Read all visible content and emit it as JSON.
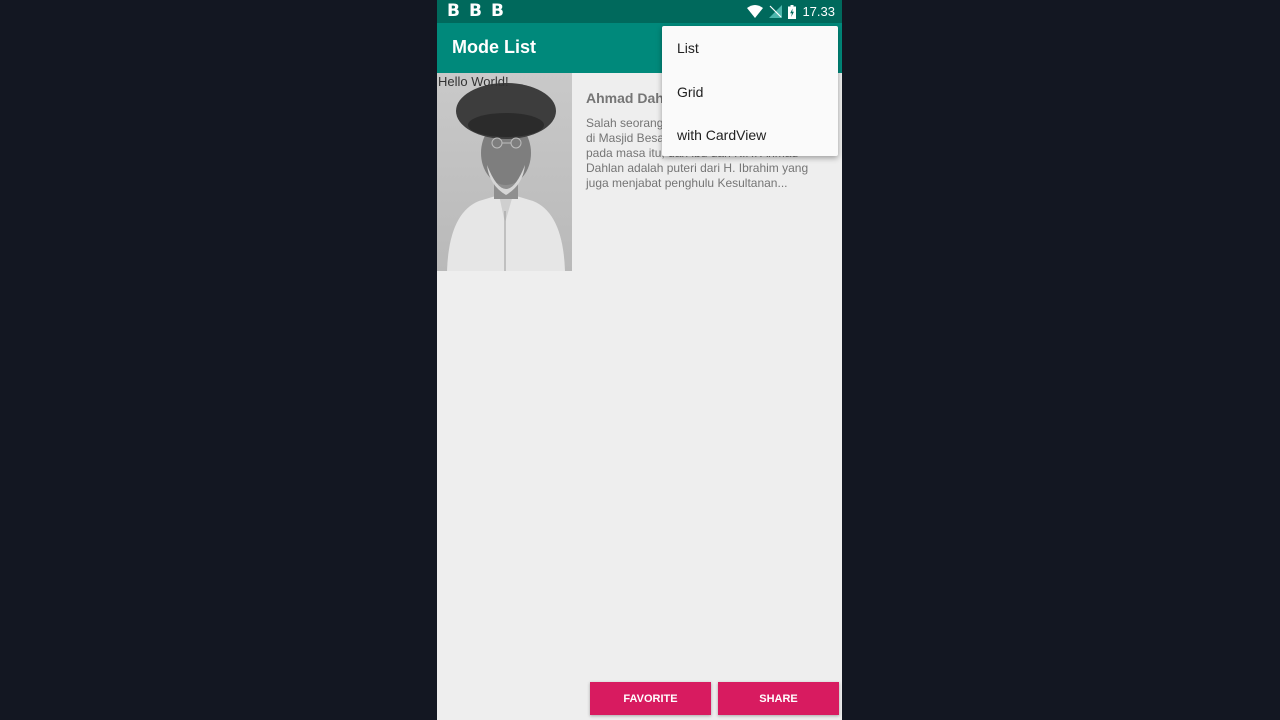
{
  "status_bar": {
    "notifications": [
      "B",
      "B",
      "B"
    ],
    "time": "17.33"
  },
  "app_bar": {
    "title": "Mode List"
  },
  "item": {
    "overlay_text": "Hello World!",
    "name": "Ahmad Dahlan",
    "description": "Salah seorang ulama dan khatib terkemuka di Masjid Besar Kasultanan Yogyakarta pada masa itu, dan ibu dari K.H. Ahmad Dahlan adalah puteri dari H. Ibrahim yang juga menjabat penghulu Kesultanan..."
  },
  "buttons": {
    "favorite": "FAVORITE",
    "share": "SHARE"
  },
  "overflow_menu": {
    "items": [
      {
        "label": "List"
      },
      {
        "label": "Grid"
      },
      {
        "label": "with CardView"
      }
    ]
  },
  "colors": {
    "status_bar": "#00695c",
    "app_bar": "#00897b",
    "accent": "#d81b60",
    "background": "#eeeeee",
    "outer_background": "#131722"
  },
  "icons": [
    "wifi-icon",
    "no-signal-icon",
    "battery-charging-icon",
    "portrait-photo"
  ]
}
